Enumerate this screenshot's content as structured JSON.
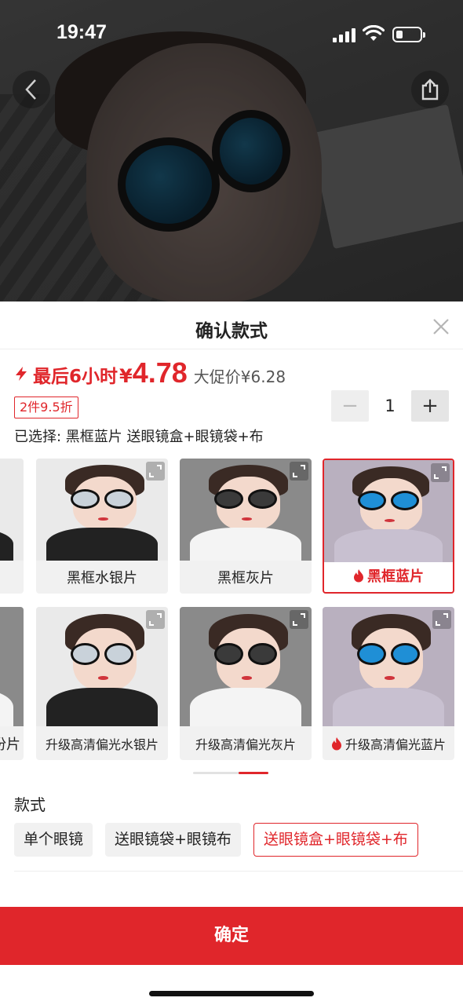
{
  "status_bar": {
    "time": "19:47"
  },
  "sheet": {
    "title": "确认款式",
    "countdown": "最后6小时",
    "price_symbol": "¥",
    "price": "4.78",
    "orig_price": "大促价¥6.28",
    "promo": "2件9.5折",
    "quantity": "1",
    "selected": "已选择: 黑框蓝片 送眼镜盒+眼镜袋+布"
  },
  "colors": {
    "accent": "#e0262b"
  },
  "variants": [
    {
      "label": "黑框水银片",
      "selected": false,
      "hot": false
    },
    {
      "label": "黑框灰片",
      "selected": false,
      "hot": false
    },
    {
      "label": "黑框蓝片",
      "selected": true,
      "hot": true
    },
    {
      "label": "升级高清偏光水银片",
      "selected": false,
      "hot": false
    },
    {
      "label": "升级高清偏光灰片",
      "selected": false,
      "hot": false
    },
    {
      "label": "升级高清偏光蓝片",
      "selected": false,
      "hot": true
    }
  ],
  "partial_variants": [
    {
      "label": ""
    },
    {
      "label": "份片"
    }
  ],
  "styles": {
    "title": "款式",
    "options": [
      {
        "label": "单个眼镜",
        "selected": false
      },
      {
        "label": "送眼镜袋+眼镜布",
        "selected": false
      },
      {
        "label": "送眼镜盒+眼镜袋+布",
        "selected": true
      }
    ]
  },
  "confirm_label": "确定",
  "icons": {
    "back": "chevron-left-icon",
    "share": "share-icon",
    "close": "close-icon",
    "flash": "flash-icon",
    "hot": "fire-icon",
    "expand": "expand-icon"
  }
}
